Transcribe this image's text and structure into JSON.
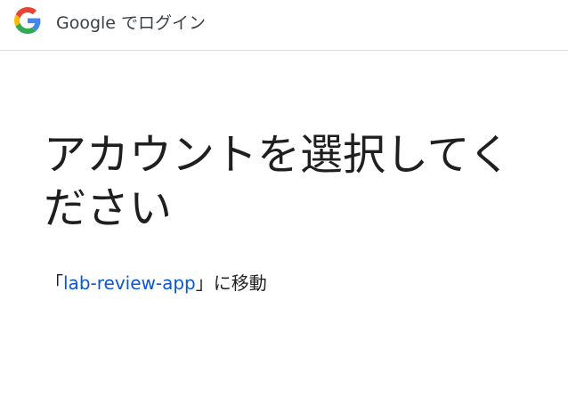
{
  "header": {
    "title": "Google でログイン",
    "logo_icon": "google-g-icon"
  },
  "main": {
    "heading": "アカウントを選択してください",
    "subtitle": {
      "open_bracket": "「",
      "app_name": "lab-review-app",
      "close_bracket": "」",
      "suffix": "に移動"
    }
  },
  "colors": {
    "link": "#0b57d0",
    "text": "#1f1f1f",
    "divider": "#dadce0",
    "google_blue": "#4285F4",
    "google_red": "#EA4335",
    "google_yellow": "#FBBC05",
    "google_green": "#34A853"
  }
}
